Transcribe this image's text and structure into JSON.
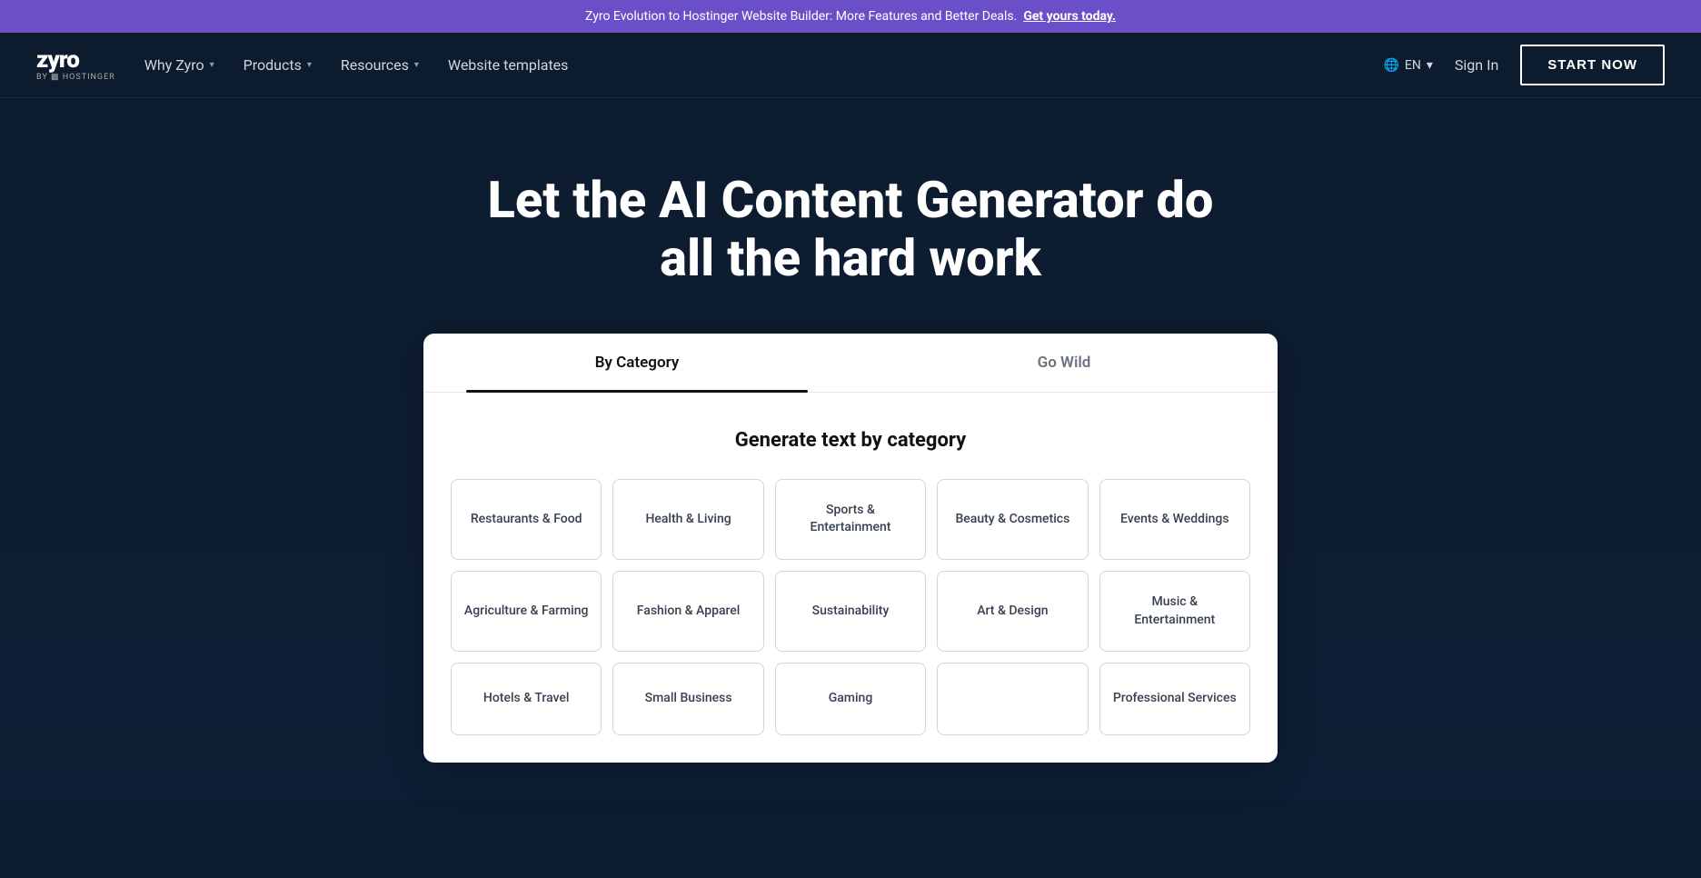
{
  "banner": {
    "text": "Zyro Evolution to Hostinger Website Builder: More Features and Better Deals.",
    "link_text": "Get yours today.",
    "link_url": "#"
  },
  "navbar": {
    "logo": {
      "brand": "zyro",
      "sub": "by ⊞ hostinger"
    },
    "why_zyro": "Why Zyro",
    "products": "Products",
    "resources": "Resources",
    "website_templates": "Website templates",
    "lang": "EN",
    "sign_in": "Sign In",
    "start_now": "START NOW"
  },
  "hero": {
    "line1": "Let the AI Content Generator do",
    "line2": "all the hard work"
  },
  "tabs": [
    {
      "id": "by-category",
      "label": "By Category",
      "active": true
    },
    {
      "id": "go-wild",
      "label": "Go Wild",
      "active": false
    }
  ],
  "generate": {
    "heading": "Generate text by category"
  },
  "categories": [
    {
      "label": "Restaurants & Food"
    },
    {
      "label": "Health & Living"
    },
    {
      "label": "Sports & Entertainment"
    },
    {
      "label": "Beauty & Cosmetics"
    },
    {
      "label": "Events & Weddings"
    },
    {
      "label": "Agriculture & Farming"
    },
    {
      "label": "Fashion & Apparel"
    },
    {
      "label": "Sustainability"
    },
    {
      "label": "Art & Design"
    },
    {
      "label": "Music & Entertainment"
    },
    {
      "label": "Hotels & Travel"
    },
    {
      "label": "Small Business"
    },
    {
      "label": "Gaming"
    },
    {
      "label": ""
    },
    {
      "label": "Professional Services"
    }
  ]
}
